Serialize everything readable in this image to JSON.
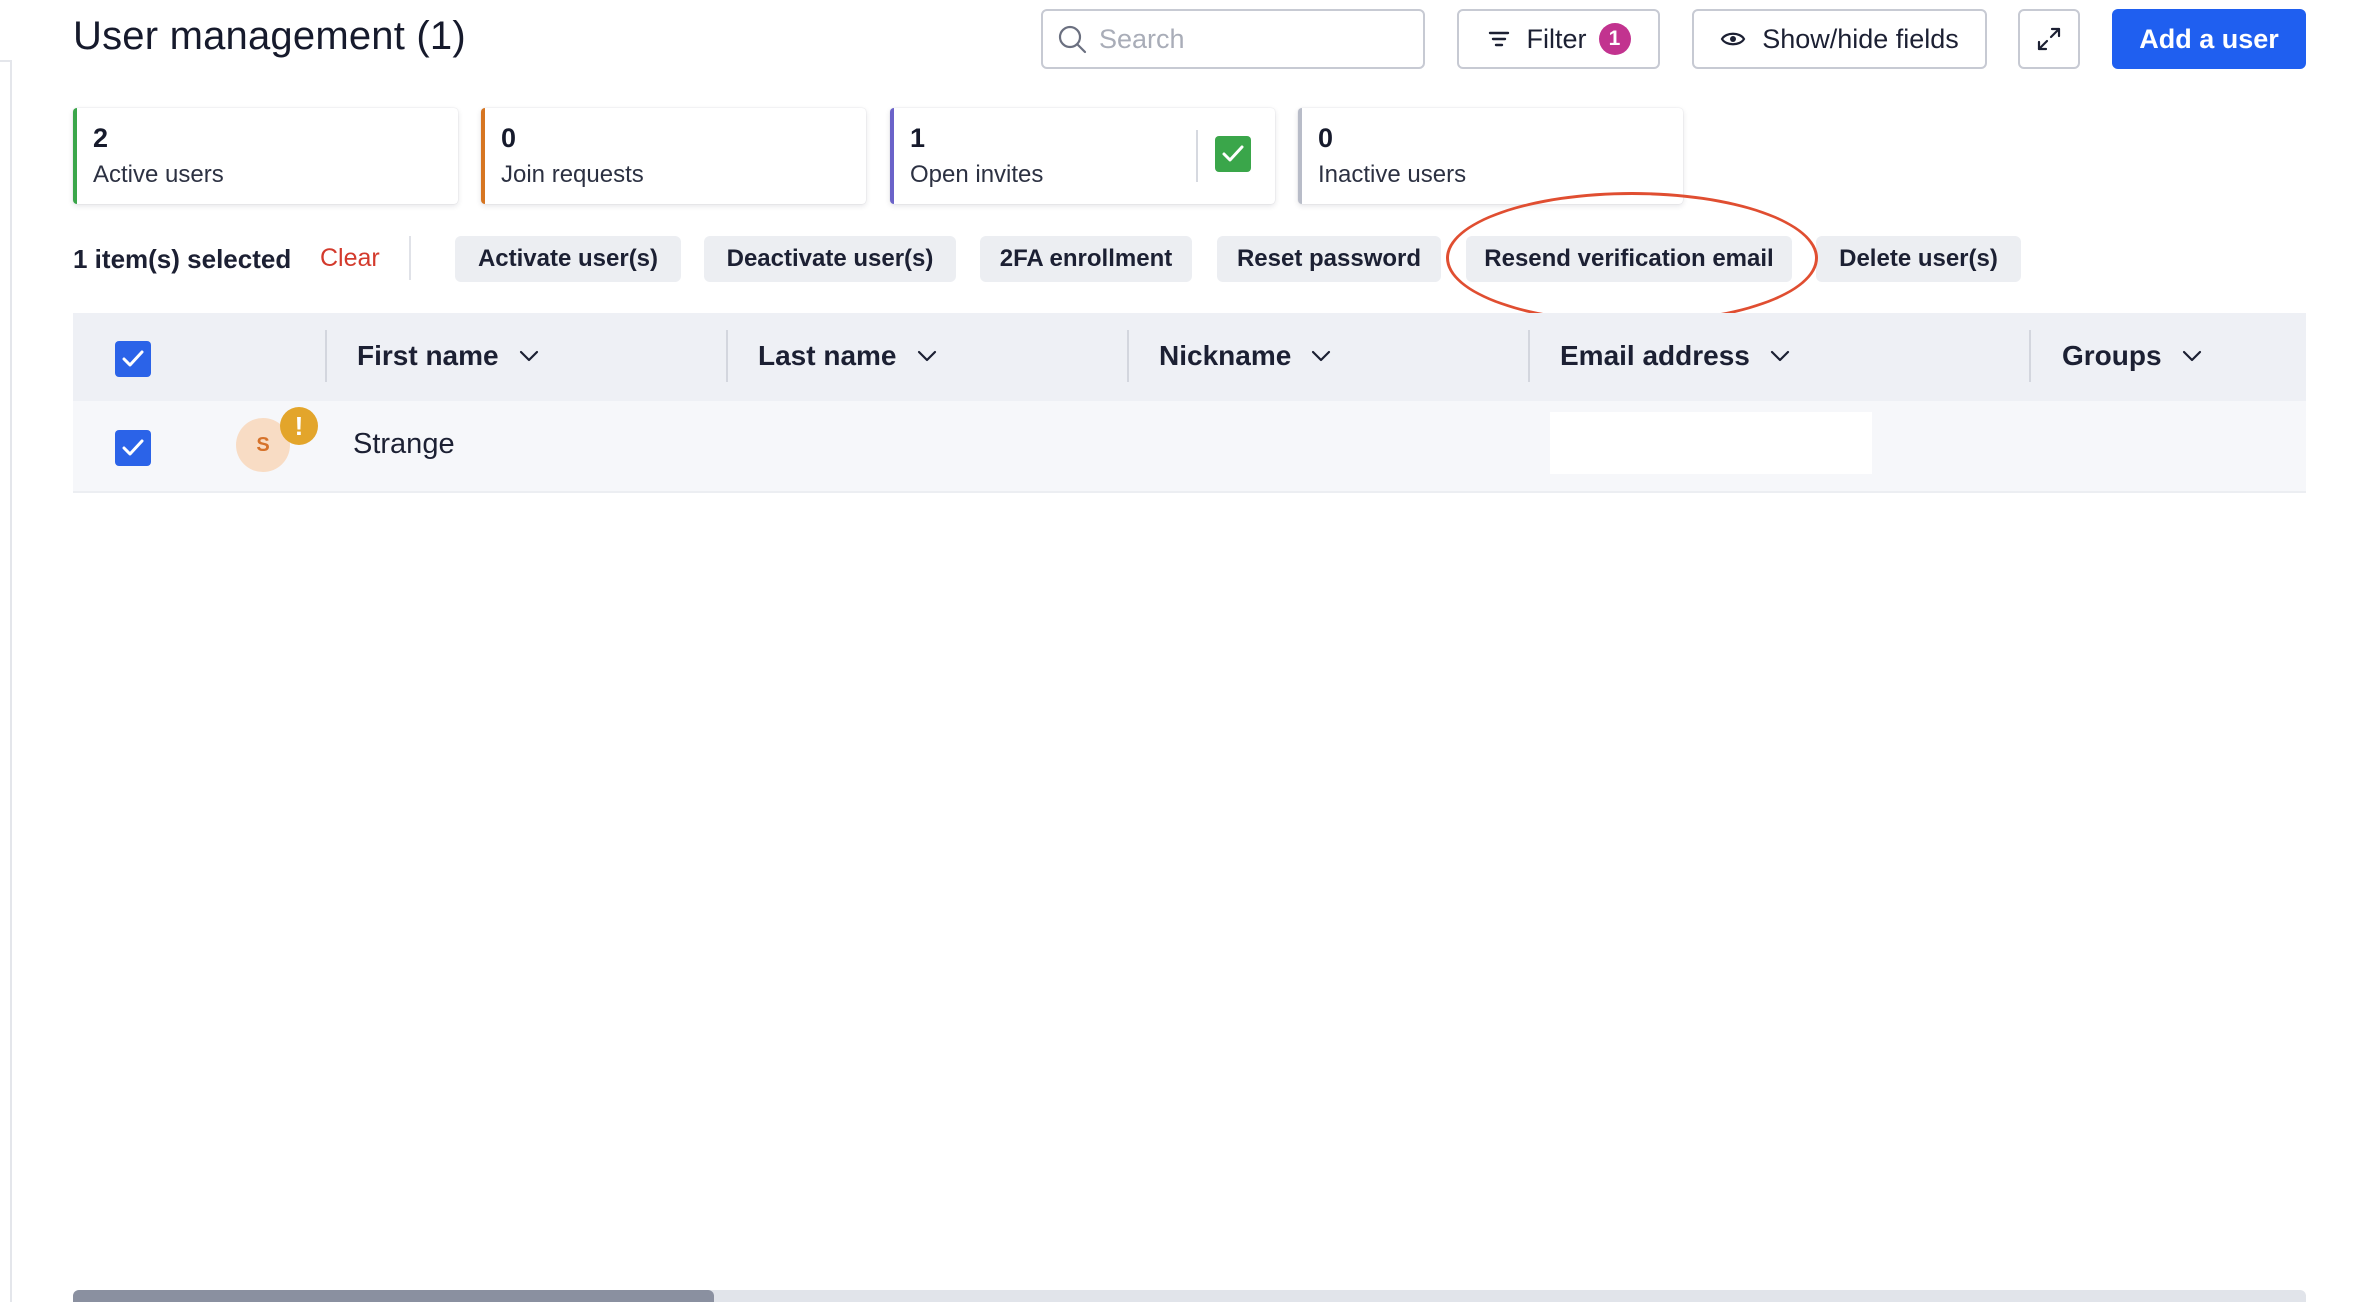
{
  "header": {
    "title": "User management (1)",
    "search_placeholder": "Search",
    "filter_label": "Filter",
    "filter_count": "1",
    "fields_label": "Show/hide fields",
    "add_label": "Add a user"
  },
  "stats": [
    {
      "count": "2",
      "label": "Active users",
      "accent": "#3aa64a"
    },
    {
      "count": "0",
      "label": "Join requests",
      "accent": "#d67521"
    },
    {
      "count": "1",
      "label": "Open invites",
      "accent": "#6b63c9"
    },
    {
      "count": "0",
      "label": "Inactive users",
      "accent": "#b8bcc8"
    }
  ],
  "selection": {
    "count_label": "1 item(s) selected",
    "clear_label": "Clear"
  },
  "actions": [
    "Activate user(s)",
    "Deactivate user(s)",
    "2FA enrollment",
    "Reset password",
    "Resend verification email",
    "Delete user(s)"
  ],
  "table": {
    "columns": [
      "First name",
      "Last name",
      "Nickname",
      "Email address",
      "Groups"
    ],
    "rows": [
      {
        "avatar_initial": "S",
        "warning_glyph": "!",
        "first_name": "Strange",
        "last_name": "",
        "nickname": "",
        "email": "",
        "groups": "",
        "selected": true
      }
    ]
  },
  "colors": {
    "primary": "#1f5ff0",
    "danger": "#d33a2c",
    "badge": "#c2338f",
    "callout": "#e04e31"
  }
}
